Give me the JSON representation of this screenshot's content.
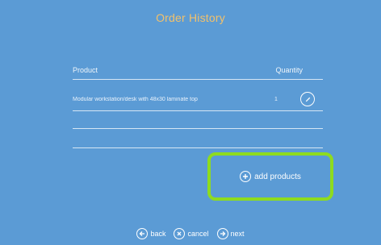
{
  "title": "Order History",
  "table": {
    "headers": {
      "product": "Product",
      "quantity": "Quantity"
    },
    "rows": [
      {
        "product": "Modular workstation/desk with 48x30 laminate top",
        "quantity": "1"
      }
    ]
  },
  "actions": {
    "add_label": "add products"
  },
  "nav": {
    "back_label": "back",
    "cancel_label": "cancel",
    "next_label": "next"
  },
  "colors": {
    "background": "#5b9bd5",
    "title": "#f2c16b",
    "highlight": "#8edb1f"
  }
}
